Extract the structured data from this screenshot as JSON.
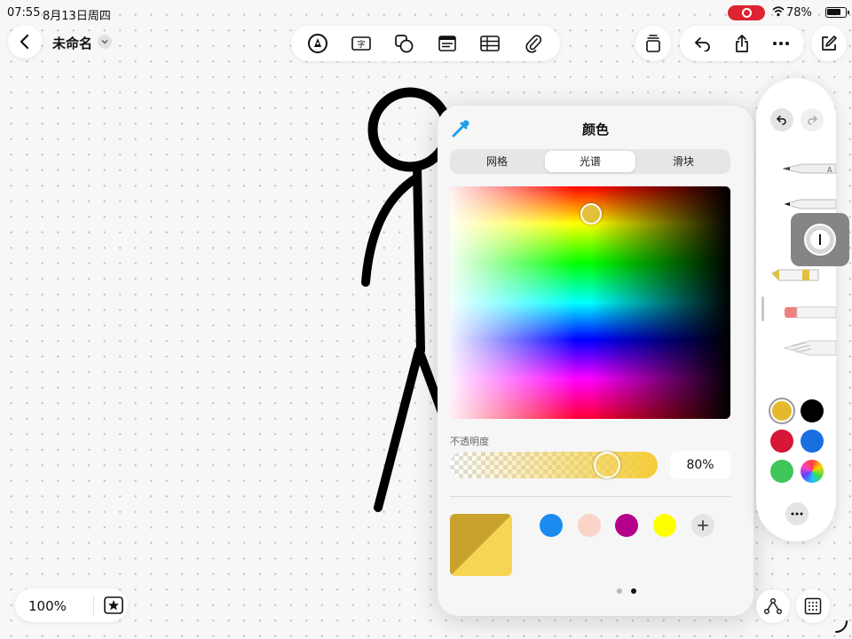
{
  "status_bar": {
    "time": "07:55",
    "date": "8月13日周四",
    "battery": "78%"
  },
  "header": {
    "title": "未命名"
  },
  "toolbar": {
    "tools": [
      "pen-tool-icon",
      "text-box-icon",
      "shapes-icon",
      "sticky-note-icon",
      "table-icon",
      "attachment-icon"
    ]
  },
  "color_panel": {
    "title": "颜色",
    "tabs": [
      "网格",
      "光谱",
      "滑块"
    ],
    "active_tab": "光谱",
    "selected_color": "#e3c03c",
    "opacity_label": "不透明度",
    "opacity_value": "80%",
    "opacity_fraction": 0.8,
    "previous_color": "#c9a22d",
    "current_color": "#f6d454",
    "saved_swatches": [
      "#1a8cef",
      "#fad4c6",
      "#b5008c",
      "#ffff00"
    ],
    "page_count": 2,
    "active_page": 2
  },
  "palette": {
    "colors": [
      "#e5b92b",
      "#000000",
      "#d71537",
      "#1a6fe0",
      "#3ec65a",
      "multicolor"
    ],
    "selected_color_index": 0
  },
  "zoom": {
    "value": "100%"
  }
}
